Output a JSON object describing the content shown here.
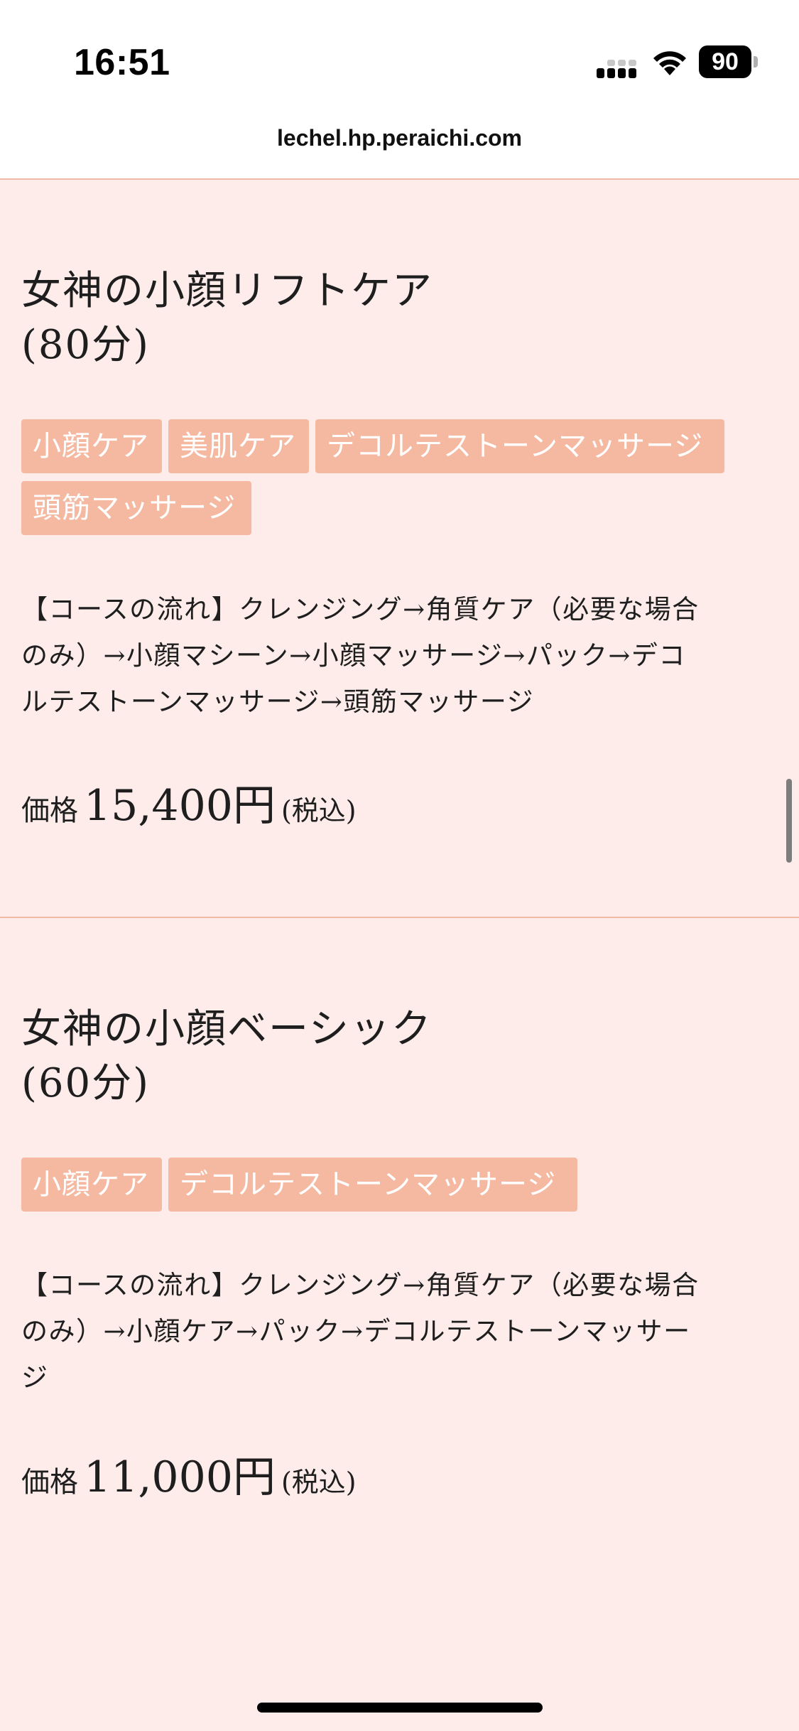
{
  "status_bar": {
    "time": "16:51",
    "battery_level": "90",
    "icons": [
      "cellular-signal-icon",
      "wifi-icon",
      "battery-icon"
    ]
  },
  "browser": {
    "url": "lechel.hp.peraichi.com"
  },
  "courses": [
    {
      "title_line1": "女神の小顔リフトケア",
      "title_line2": "(80分)",
      "tags": [
        "小顔ケア",
        "美肌ケア",
        "デコルテストーンマッサージ",
        "頭筋マッサージ"
      ],
      "description_lines": [
        "【コースの流れ】クレンジング→角質ケア（必要な場合",
        "のみ）→小顔マシーン→小顔マッサージ→パック→デコ",
        "ルテストーンマッサージ→頭筋マッサージ"
      ],
      "price_label": "価格",
      "price_value": "15,400円",
      "price_tax": "(税込)"
    },
    {
      "title_line1": "女神の小顔ベーシック",
      "title_line2": "(60分)",
      "tags": [
        "小顔ケア",
        "デコルテストーンマッサージ"
      ],
      "description_lines": [
        "【コースの流れ】クレンジング→角質ケア（必要な場合",
        "のみ）→小顔ケア→パック→デコルテストーンマッサー",
        "ジ"
      ],
      "price_label": "価格",
      "price_value": "11,000円",
      "price_tax": "(税込)"
    }
  ],
  "colors": {
    "page_background": "#fdecea",
    "tag_background": "#f5b9a1",
    "tag_text": "#ffffff",
    "divider": "#f3b9a7"
  }
}
